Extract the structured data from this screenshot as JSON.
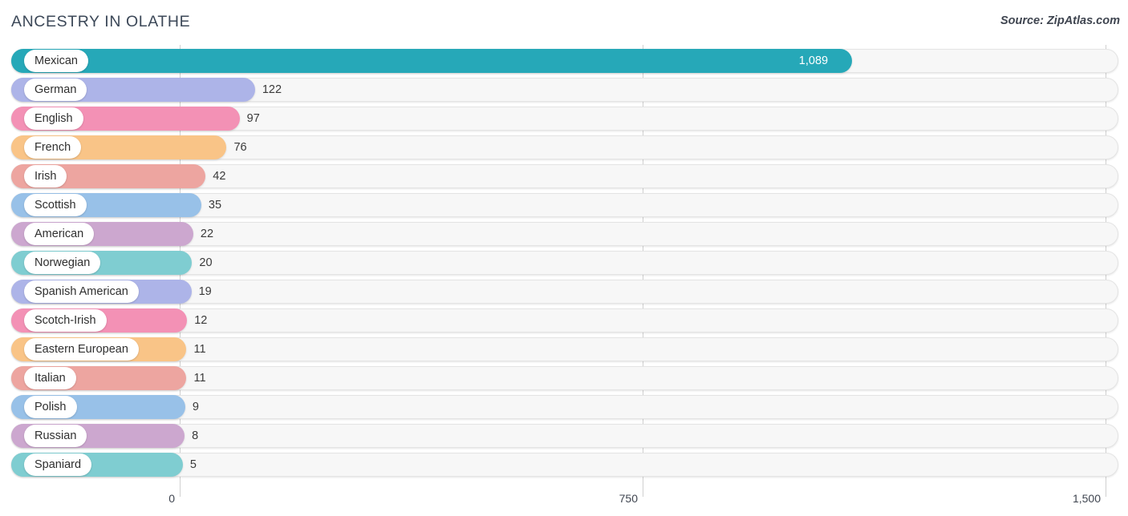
{
  "header": {
    "title": "ANCESTRY IN OLATHE",
    "source": "Source: ZipAtlas.com"
  },
  "chart_data": {
    "type": "bar",
    "orientation": "horizontal",
    "title": "ANCESTRY IN OLATHE",
    "xlabel": "",
    "ylabel": "",
    "xlim": [
      0,
      1500
    ],
    "xticks": [
      0,
      750,
      1500
    ],
    "xtick_labels": [
      "0",
      "750",
      "1,500"
    ],
    "grid": true,
    "legend": false,
    "categories": [
      "Mexican",
      "German",
      "English",
      "French",
      "Irish",
      "Scottish",
      "American",
      "Norwegian",
      "Spanish American",
      "Scotch-Irish",
      "Eastern European",
      "Italian",
      "Polish",
      "Russian",
      "Spaniard"
    ],
    "values": [
      1089,
      122,
      97,
      76,
      42,
      35,
      22,
      20,
      19,
      12,
      11,
      11,
      9,
      8,
      5
    ],
    "value_labels": [
      "1,089",
      "122",
      "97",
      "76",
      "42",
      "35",
      "22",
      "20",
      "19",
      "12",
      "11",
      "11",
      "9",
      "8",
      "5"
    ],
    "colors": [
      "#26a8b8",
      "#adb4e8",
      "#f391b5",
      "#f9c487",
      "#eda5a0",
      "#98c1e8",
      "#cca7cf",
      "#7fcdd1",
      "#adb4e8",
      "#f391b5",
      "#f9c487",
      "#eda5a0",
      "#98c1e8",
      "#cca7cf",
      "#7fcdd1"
    ],
    "rows": [
      {
        "label": "Mexican",
        "value": 1089,
        "value_label": "1,089",
        "color": "#26a8b8",
        "label_inside": true
      },
      {
        "label": "German",
        "value": 122,
        "value_label": "122",
        "color": "#adb4e8",
        "label_inside": false
      },
      {
        "label": "English",
        "value": 97,
        "value_label": "97",
        "color": "#f391b5",
        "label_inside": false
      },
      {
        "label": "French",
        "value": 76,
        "value_label": "76",
        "color": "#f9c487",
        "label_inside": false
      },
      {
        "label": "Irish",
        "value": 42,
        "value_label": "42",
        "color": "#eda5a0",
        "label_inside": false
      },
      {
        "label": "Scottish",
        "value": 35,
        "value_label": "35",
        "color": "#98c1e8",
        "label_inside": false
      },
      {
        "label": "American",
        "value": 22,
        "value_label": "22",
        "color": "#cca7cf",
        "label_inside": false
      },
      {
        "label": "Norwegian",
        "value": 20,
        "value_label": "20",
        "color": "#7fcdd1",
        "label_inside": false
      },
      {
        "label": "Spanish American",
        "value": 19,
        "value_label": "19",
        "color": "#adb4e8",
        "label_inside": false
      },
      {
        "label": "Scotch-Irish",
        "value": 12,
        "value_label": "12",
        "color": "#f391b5",
        "label_inside": false
      },
      {
        "label": "Eastern European",
        "value": 11,
        "value_label": "11",
        "color": "#f9c487",
        "label_inside": false
      },
      {
        "label": "Italian",
        "value": 11,
        "value_label": "11",
        "color": "#eda5a0",
        "label_inside": false
      },
      {
        "label": "Polish",
        "value": 9,
        "value_label": "9",
        "color": "#98c1e8",
        "label_inside": false
      },
      {
        "label": "Russian",
        "value": 8,
        "value_label": "8",
        "color": "#cca7cf",
        "label_inside": false
      },
      {
        "label": "Spaniard",
        "value": 5,
        "value_label": "5",
        "color": "#7fcdd1",
        "label_inside": false
      }
    ]
  }
}
